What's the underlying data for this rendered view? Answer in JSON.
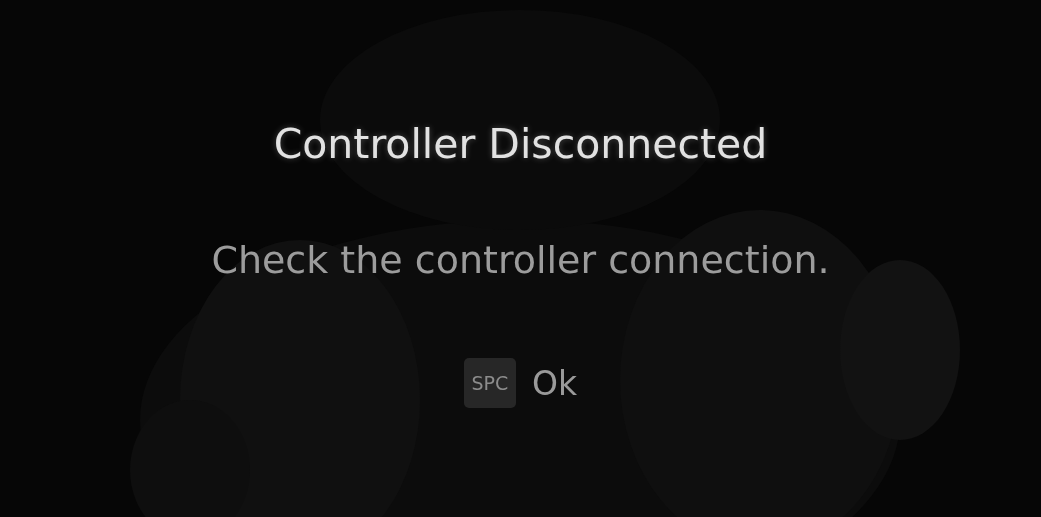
{
  "dialog": {
    "title": "Controller Disconnected",
    "message": "Check the controller connection."
  },
  "prompts": [
    {
      "key": "SPC",
      "label": "Ok"
    }
  ]
}
